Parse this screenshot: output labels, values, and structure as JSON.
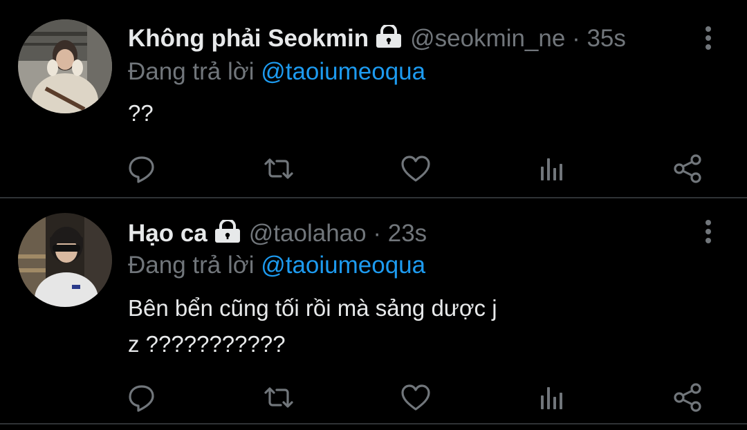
{
  "tweets": [
    {
      "display_name": "Không phải Seokmin",
      "handle": "@seokmin_ne",
      "separator": "·",
      "time": "35s",
      "reply_prefix": "Đang trả lời",
      "reply_to": "@taoiumeoqua",
      "text": "??"
    },
    {
      "display_name": "Hạo ca",
      "handle": "@taolahao",
      "separator": "·",
      "time": "23s",
      "reply_prefix": "Đang trả lời",
      "reply_to": "@taoiumeoqua",
      "text": "Bên bển cũng tối rồi mà sảng dược j\nz ???????????"
    }
  ],
  "icons": {
    "lock": "lock-icon",
    "more": "more-vertical-icon",
    "reply": "reply-icon",
    "retweet": "retweet-icon",
    "like": "heart-icon",
    "views": "views-icon",
    "share": "share-icon"
  },
  "colors": {
    "background": "#000000",
    "text": "#e7e9ea",
    "secondary": "#71767b",
    "accent": "#1d9bf0",
    "divider": "#2f3336"
  }
}
